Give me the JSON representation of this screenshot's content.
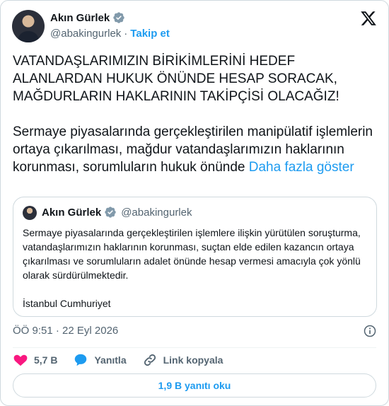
{
  "author": {
    "name": "Akın Gürlek",
    "handle": "@abakingurlek",
    "separator": "·",
    "follow_label": "Takip et"
  },
  "tweet": {
    "line1": "VATANDAŞLARIMIZIN BİRİKİMLERİNİ HEDEF ALANLARDAN HUKUK ÖNÜNDE HESAP SORACAK, MAĞDURLARIN HAKLARININ TAKİPÇİSİ OLACAĞIZ!",
    "line2": "Sermaye piyasalarında gerçekleştirilen manipülatif işlemlerin ortaya çıkarılması, mağdur vatandaşlarımızın haklarının korunması, sorumluların hukuk önünde ",
    "show_more": "Daha fazla göster"
  },
  "quote": {
    "name": "Akın Gürlek",
    "handle": "@abakingurlek",
    "body": "Sermaye piyasalarında gerçekleştirilen işlemlere ilişkin yürütülen soruşturma, vatandaşlarımızın haklarının korunması, suçtan elde edilen kazancın ortaya çıkarılması ve sorumluların adalet önünde hesap vermesi amacıyla çok yönlü olarak sürdürülmektedir.",
    "footer": "İstanbul Cumhuriyet"
  },
  "meta": {
    "timestamp": "ÖÖ 9:51 · 22 Eyl 2026"
  },
  "actions": {
    "likes": "5,7 B",
    "reply_label": "Yanıtla",
    "copy_link_label": "Link kopyala"
  },
  "read_replies": "1,9 B yanıtı oku",
  "colors": {
    "accent": "#1d9bf0",
    "like": "#f91880",
    "muted": "#536471",
    "border": "#cfd9de"
  }
}
